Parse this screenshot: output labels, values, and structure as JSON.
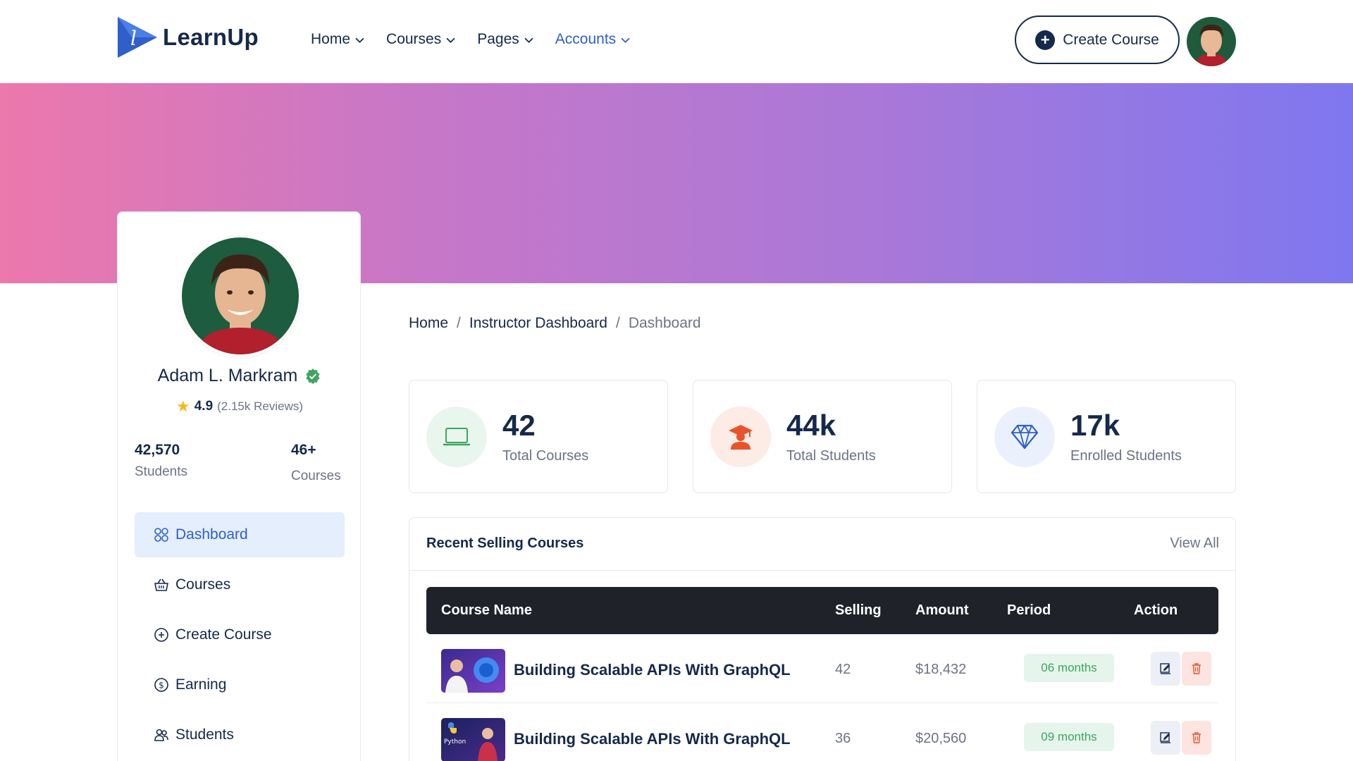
{
  "brand": {
    "name": "LearnUp"
  },
  "nav": [
    {
      "label": "Home"
    },
    {
      "label": "Courses"
    },
    {
      "label": "Pages"
    },
    {
      "label": "Accounts"
    }
  ],
  "header": {
    "create_course_label": "Create Course"
  },
  "profile": {
    "name": "Adam L. Markram",
    "rating": "4.9",
    "reviews": "(2.15k Reviews)",
    "students_count": "42,570",
    "students_label": "Students",
    "courses_count": "46+",
    "courses_label": "Courses"
  },
  "sidebar": {
    "items": [
      {
        "label": "Dashboard",
        "icon": "dashboard-icon",
        "active": true
      },
      {
        "label": "Courses",
        "icon": "basket-icon"
      },
      {
        "label": "Create Course",
        "icon": "plus-circle-icon"
      },
      {
        "label": "Earning",
        "icon": "dollar-circle-icon"
      },
      {
        "label": "Students",
        "icon": "users-icon"
      }
    ]
  },
  "breadcrumb": [
    "Home",
    "Instructor Dashboard",
    "Dashboard"
  ],
  "breadcrumb_separator": "/",
  "stats": [
    {
      "value": "42",
      "label": "Total Courses",
      "icon": "laptop-icon",
      "color": "#3da55f"
    },
    {
      "value": "44k",
      "label": "Total Students",
      "icon": "graduate-icon",
      "color": "#e8532b"
    },
    {
      "value": "17k",
      "label": "Enrolled Students",
      "icon": "diamond-icon",
      "color": "#2f5fc9"
    }
  ],
  "recent": {
    "title": "Recent Selling Courses",
    "view_all": "View All",
    "columns": [
      "Course Name",
      "Selling",
      "Amount",
      "Period",
      "Action"
    ],
    "rows": [
      {
        "name": "Building Scalable APIs With GraphQL",
        "selling": "42",
        "amount": "$18,432",
        "period": "06 months"
      },
      {
        "name": "Building Scalable APIs With GraphQL",
        "selling": "36",
        "amount": "$20,560",
        "period": "09 months",
        "thumb_text": "Python"
      }
    ]
  },
  "colors": {
    "primary": "#15294b",
    "accent": "#2f5fc9",
    "banner_start": "#ec78ac",
    "banner_end": "#7f77ef",
    "success": "#3da55f",
    "danger": "#e8532b"
  }
}
